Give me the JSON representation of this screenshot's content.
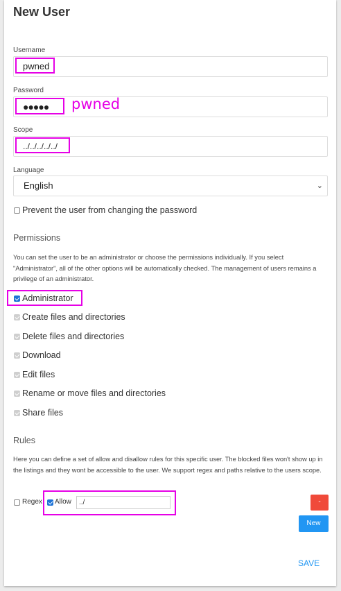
{
  "form": {
    "title": "New User",
    "username": {
      "label": "Username",
      "value": "pwned"
    },
    "password": {
      "label": "Password",
      "value": "●●●●●",
      "annotation": "pwned"
    },
    "scope": {
      "label": "Scope",
      "value": "../../../../../"
    },
    "language": {
      "label": "Language",
      "value": "English"
    },
    "prevent_change": {
      "label": "Prevent the user from changing the password",
      "checked": false
    }
  },
  "permissions": {
    "heading": "Permissions",
    "description": "You can set the user to be an administrator or choose the permissions individually. If you select \"Administrator\", all of the other options will be automatically checked. The management of users remains a privilege of an administrator.",
    "items": [
      {
        "label": "Administrator",
        "checked": true,
        "disabled": false
      },
      {
        "label": "Create files and directories",
        "checked": true,
        "disabled": true
      },
      {
        "label": "Delete files and directories",
        "checked": true,
        "disabled": true
      },
      {
        "label": "Download",
        "checked": true,
        "disabled": true
      },
      {
        "label": "Edit files",
        "checked": true,
        "disabled": true
      },
      {
        "label": "Rename or move files and directories",
        "checked": true,
        "disabled": true
      },
      {
        "label": "Share files",
        "checked": true,
        "disabled": true
      }
    ]
  },
  "rules": {
    "heading": "Rules",
    "description": "Here you can define a set of allow and disallow rules for this specific user. The blocked files won't show up in the listings and they wont be accessible to the user. We support regex and paths relative to the users scope.",
    "regex_label": "Regex",
    "allow_label": "Allow",
    "rule_value": "../",
    "remove_label": "-",
    "new_label": "New"
  },
  "actions": {
    "save_label": "SAVE"
  },
  "colors": {
    "highlight": "#e600e6",
    "primary": "#2196f3",
    "danger": "#f04a3a"
  }
}
